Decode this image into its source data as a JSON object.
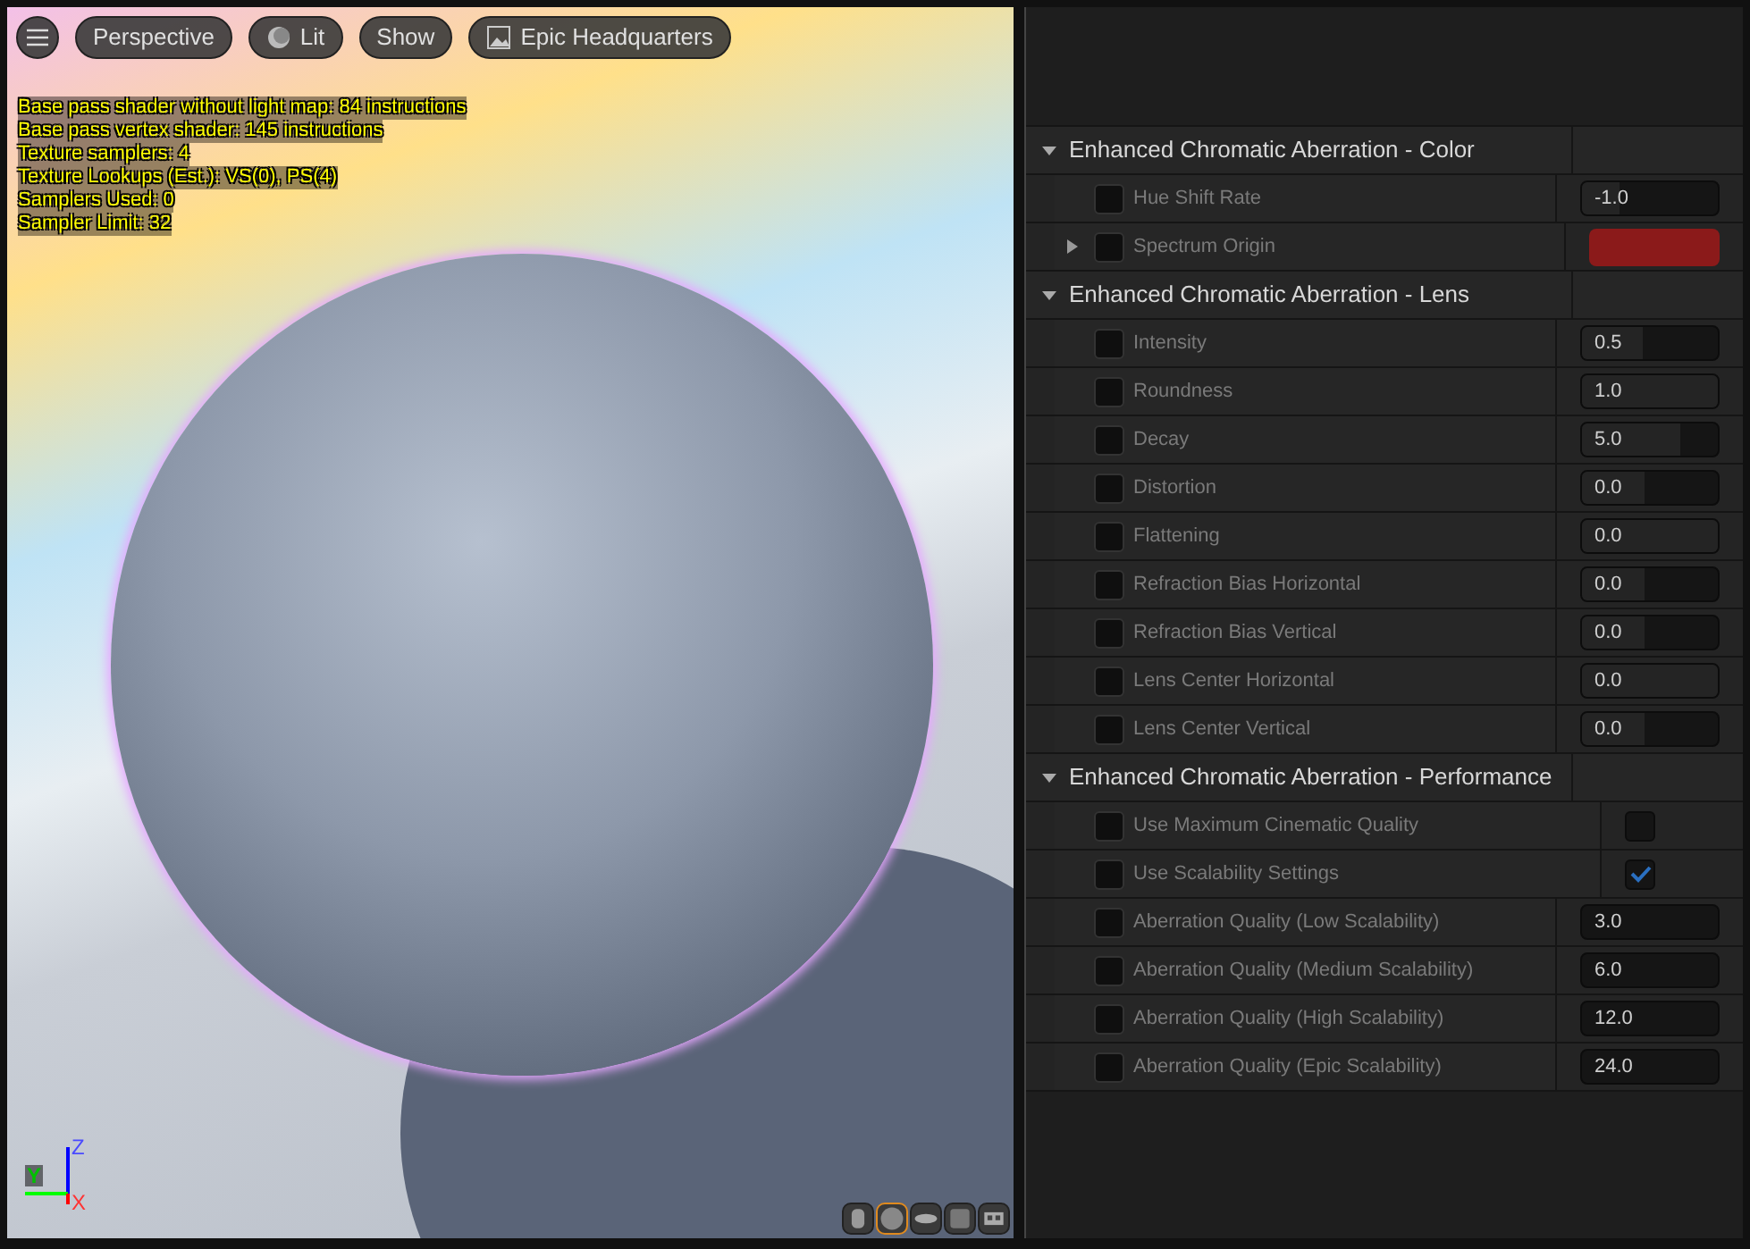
{
  "viewport": {
    "toolbar": [
      {
        "kind": "menu"
      },
      {
        "kind": "text",
        "label": "Perspective"
      },
      {
        "kind": "lit",
        "label": "Lit"
      },
      {
        "kind": "text",
        "label": "Show"
      },
      {
        "kind": "level",
        "label": "Epic Headquarters"
      }
    ],
    "stats": [
      "Base pass shader without light map: 84 instructions",
      "Base pass vertex shader: 145 instructions",
      "Texture samplers: 4",
      "Texture Lookups (Est.): VS(0), PS(4)",
      "Samplers Used: 0",
      "Sampler Limit: 32"
    ],
    "axis": {
      "z": "Z",
      "y": "Y",
      "x": "X"
    },
    "preview_shapes": [
      {
        "kind": "cylinder",
        "selected": false
      },
      {
        "kind": "sphere",
        "selected": true
      },
      {
        "kind": "plane",
        "selected": false
      },
      {
        "kind": "cube",
        "selected": false
      },
      {
        "kind": "mesh",
        "selected": false
      }
    ]
  },
  "details": {
    "sections": [
      {
        "title": "Enhanced Chromatic Aberration - Color",
        "expanded": true,
        "rows": [
          {
            "label": "Hue Shift Rate",
            "kind": "slider",
            "value": "-1.0",
            "level": 0.28,
            "overridden": false,
            "has_children": false
          },
          {
            "label": "Spectrum Origin",
            "kind": "color",
            "color": "#8b1a1a",
            "overridden": false,
            "has_children": true
          }
        ]
      },
      {
        "title": "Enhanced Chromatic Aberration - Lens",
        "expanded": true,
        "rows": [
          {
            "label": "Intensity",
            "kind": "slider",
            "value": "0.5",
            "level": 0.45,
            "overridden": false,
            "has_children": false
          },
          {
            "label": "Roundness",
            "kind": "slider",
            "value": "1.0",
            "level": 1,
            "overridden": false,
            "has_children": false
          },
          {
            "label": "Decay",
            "kind": "slider",
            "value": "5.0",
            "level": 0.72,
            "overridden": false,
            "has_children": false
          },
          {
            "label": "Distortion",
            "kind": "slider",
            "value": "0.0",
            "level": 0.46,
            "overridden": false,
            "has_children": false
          },
          {
            "label": "Flattening",
            "kind": "slider",
            "value": "0.0",
            "level": 1,
            "overridden": false,
            "has_children": false
          },
          {
            "label": "Refraction Bias Horizontal",
            "kind": "slider",
            "value": "0.0",
            "level": 0.46,
            "overridden": false,
            "has_children": false
          },
          {
            "label": "Refraction Bias Vertical",
            "kind": "slider",
            "value": "0.0",
            "level": 0.46,
            "overridden": false,
            "has_children": false
          },
          {
            "label": "Lens Center Horizontal",
            "kind": "slider",
            "value": "0.0",
            "level": 1,
            "overridden": false,
            "has_children": false
          },
          {
            "label": "Lens Center Vertical",
            "kind": "slider",
            "value": "0.0",
            "level": 0.46,
            "overridden": false,
            "has_children": false
          }
        ]
      },
      {
        "title": "Enhanced Chromatic Aberration - Performance",
        "expanded": true,
        "rows": [
          {
            "label": "Use Maximum Cinematic Quality",
            "kind": "checkbox",
            "checked": false,
            "overridden": false,
            "has_children": false
          },
          {
            "label": "Use Scalability Settings",
            "kind": "checkbox",
            "checked": true,
            "overridden": false,
            "has_children": false
          },
          {
            "label": "Aberration Quality (Low Scalability)",
            "kind": "number",
            "value": "3.0",
            "overridden": false,
            "has_children": false
          },
          {
            "label": "Aberration Quality (Medium Scalability)",
            "kind": "number",
            "value": "6.0",
            "overridden": false,
            "has_children": false
          },
          {
            "label": "Aberration Quality (High Scalability)",
            "kind": "number",
            "value": "12.0",
            "overridden": false,
            "has_children": false
          },
          {
            "label": "Aberration Quality (Epic Scalability)",
            "kind": "number",
            "value": "24.0",
            "overridden": false,
            "has_children": false
          }
        ]
      }
    ]
  }
}
